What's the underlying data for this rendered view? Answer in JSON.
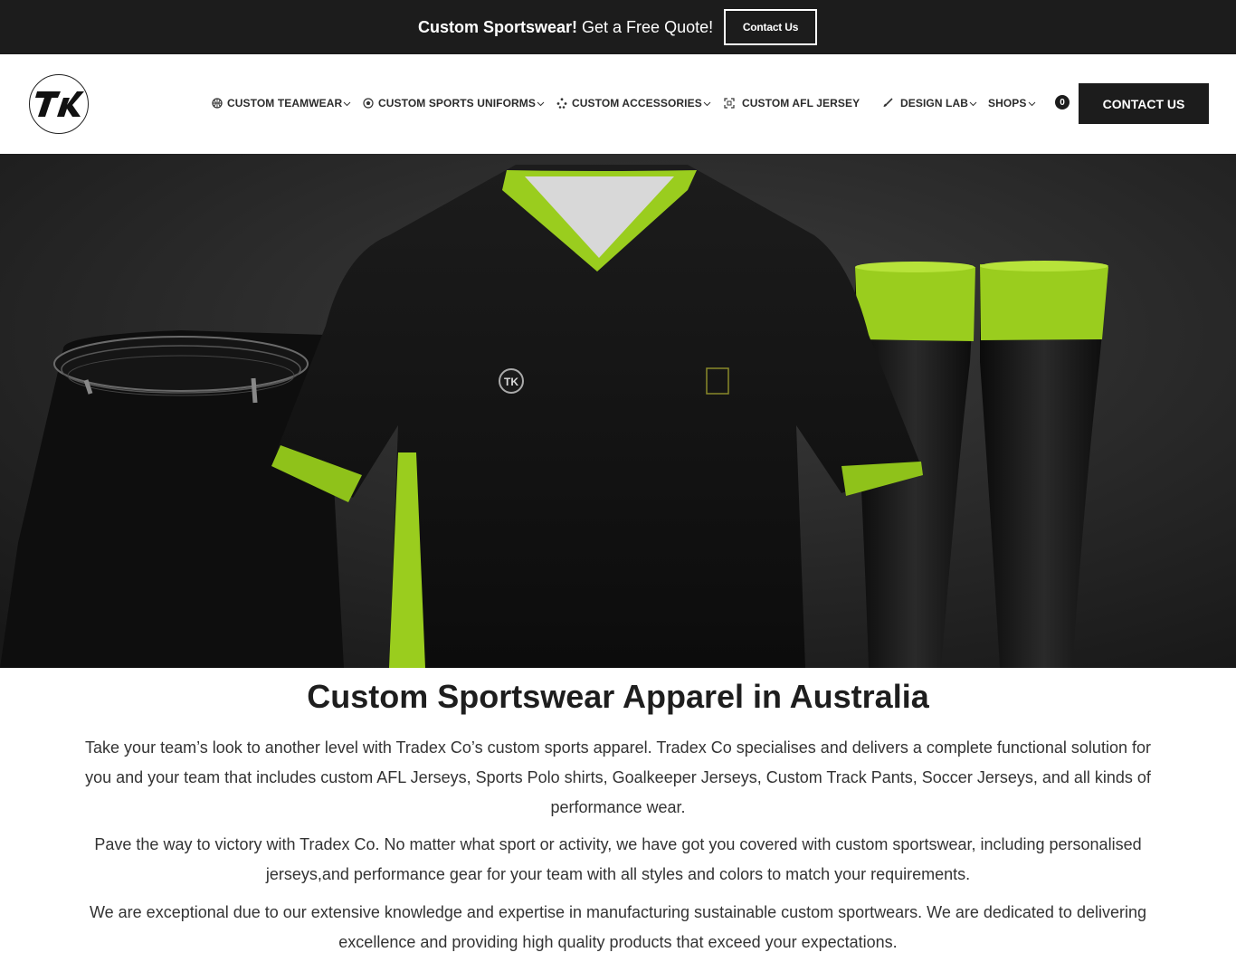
{
  "topbar": {
    "promo_bold": "Custom Sportswear!",
    "promo_text": " Get a Free Quote!",
    "contact_label": "Contact Us"
  },
  "nav": {
    "items": [
      {
        "label": "CUSTOM TEAMWEAR",
        "icon": "ball-icon",
        "dropdown": true
      },
      {
        "label": "CUSTOM SPORTS UNIFORMS",
        "icon": "soccer-icon",
        "dropdown": true
      },
      {
        "label": "CUSTOM ACCESSORIES",
        "icon": "sparkle-icon",
        "dropdown": true
      },
      {
        "label": "CUSTOM AFL JERSEY",
        "icon": "frame-icon",
        "dropdown": false
      },
      {
        "label": "DESIGN LAB",
        "icon": "brush-icon",
        "dropdown": true
      },
      {
        "label": "SHOPS",
        "icon": "",
        "dropdown": true
      }
    ],
    "cart_count": "0",
    "contact_label": "CONTACT US"
  },
  "hero": {
    "image_alt": "Black custom sports uniform with lime green trim: jersey, shorts and socks",
    "accent_color": "#9acd1e"
  },
  "content": {
    "headline": "Custom Sportswear Apparel in Australia",
    "paragraphs": [
      "Take your team’s look to another level with Tradex Co’s custom sports apparel. Tradex Co specialises and delivers a complete functional solution for you and your team that includes custom AFL Jerseys, Sports Polo shirts, Goalkeeper Jerseys, Custom Track Pants, Soccer Jerseys, and all kinds of performance wear.",
      "Pave the way to victory with Tradex Co. No matter what sport or activity, we have got you covered with custom sportswear, including personalised jerseys,and performance gear for your team with all styles and colors to match your requirements.",
      "We are exceptional due to our extensive knowledge and expertise in manufacturing sustainable custom sportwears. We are dedicated to delivering excellence and providing high quality products that exceed your expectations."
    ]
  }
}
